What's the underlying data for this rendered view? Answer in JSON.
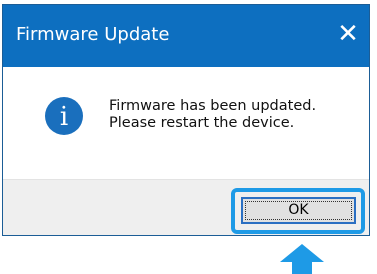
{
  "dialog": {
    "title": "Firmware Update",
    "close_glyph": "✕",
    "message_line1": "Firmware has been updated.",
    "message_line2": "Please restart the device.",
    "info_icon_letter": "i",
    "ok_label": "OK"
  },
  "colors": {
    "title_bar": "#0d6fc0",
    "info_icon": "#1a6fbd",
    "highlight": "#1e9ae6",
    "arrow": "#1e9ae6",
    "footer": "#efefef"
  },
  "icons": {
    "info": "info-icon",
    "close": "close-icon",
    "pointer": "up-arrow-icon"
  }
}
